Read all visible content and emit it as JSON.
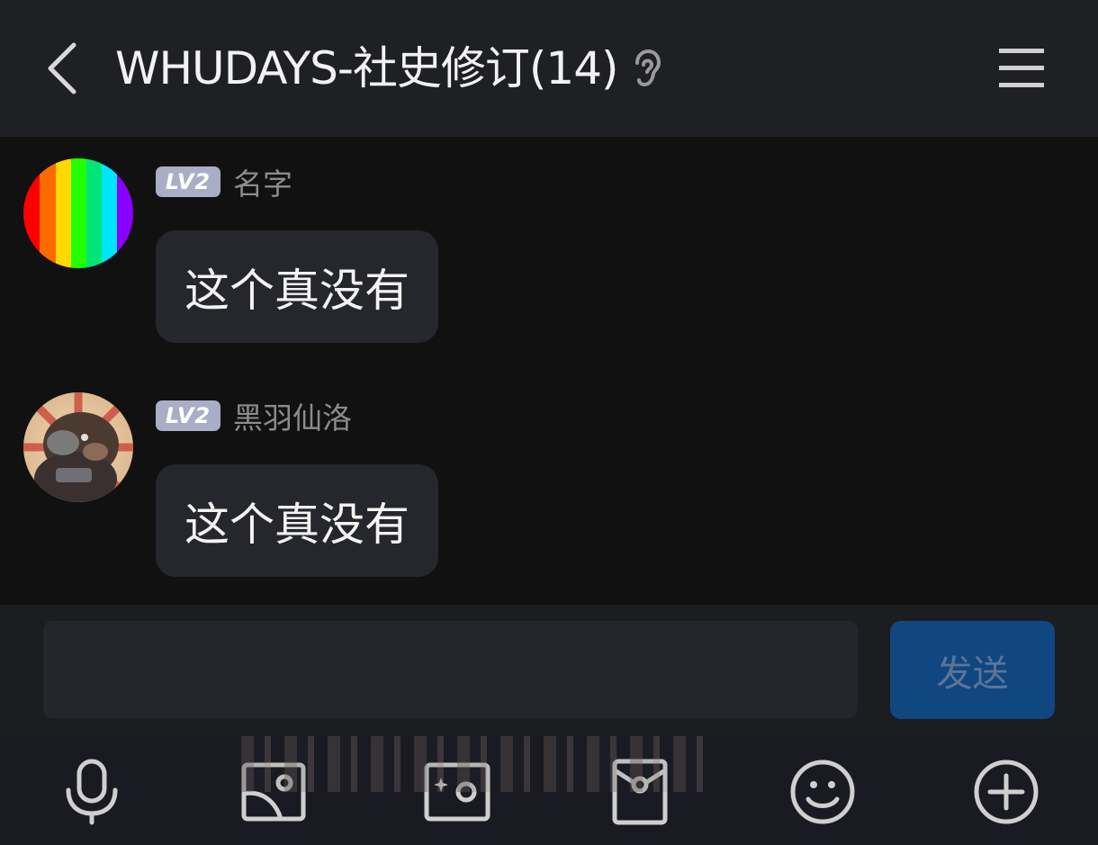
{
  "header": {
    "title": "WHUDAYS-社史修订(14)",
    "back_icon": "chevron-left-icon",
    "ear_icon": "ear-icon",
    "menu_icon": "hamburger-menu-icon"
  },
  "messages": [
    {
      "level": "LV2",
      "nickname": "名字",
      "text": "这个真没有",
      "avatar": "rainbow-stripes-avatar"
    },
    {
      "level": "LV2",
      "nickname": "黑羽仙洛",
      "text": "这个真没有",
      "avatar": "armored-bear-avatar"
    }
  ],
  "composer": {
    "value": "",
    "send_label": "发送",
    "send_color": "#114781"
  },
  "toolbar": {
    "icons": [
      "microphone-icon",
      "image-icon",
      "camera-icon",
      "red-packet-icon",
      "emoji-icon",
      "plus-circle-icon"
    ]
  },
  "colors": {
    "header_bg": "#1e2024",
    "chat_bg": "#111111",
    "bubble_bg": "#25272c",
    "badge_bg": "#a9adc6"
  }
}
